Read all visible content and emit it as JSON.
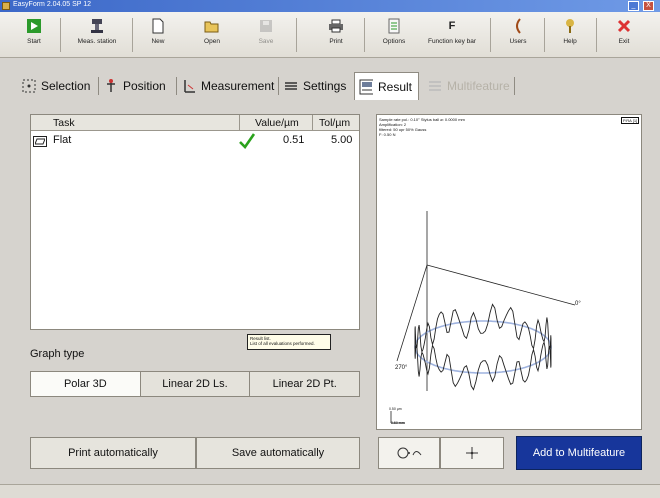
{
  "window": {
    "title": "EasyForm 2.04.05 SP 12",
    "minimize_glyph": "_",
    "close_glyph": "X"
  },
  "toolbar": [
    {
      "id": "start",
      "label": "Start",
      "icon": "play-icon",
      "enabled": true
    },
    {
      "id": "meas-station",
      "label": "Meas. station",
      "icon": "machine-icon",
      "enabled": true
    },
    {
      "id": "new",
      "label": "New",
      "icon": "new-document-icon",
      "enabled": true
    },
    {
      "id": "open",
      "label": "Open",
      "icon": "open-folder-icon",
      "enabled": true
    },
    {
      "id": "save",
      "label": "Save",
      "icon": "save-icon",
      "enabled": false
    },
    {
      "id": "print",
      "label": "Print",
      "icon": "printer-icon",
      "enabled": true
    },
    {
      "id": "options",
      "label": "Options",
      "icon": "options-icon",
      "enabled": true
    },
    {
      "id": "function-key-bar",
      "label": "Function key bar",
      "icon": "function-key-icon",
      "glyph": "F",
      "enabled": true
    },
    {
      "id": "users",
      "label": "Users",
      "icon": "users-icon",
      "enabled": true
    },
    {
      "id": "help",
      "label": "Help",
      "icon": "help-icon",
      "enabled": true
    },
    {
      "id": "exit",
      "label": "Exit",
      "icon": "exit-icon",
      "enabled": true
    }
  ],
  "tabs": [
    {
      "label": "Selection",
      "icon": "selection-icon"
    },
    {
      "label": "Position",
      "icon": "position-icon"
    },
    {
      "label": "Measurement",
      "icon": "measurement-icon"
    },
    {
      "label": "Settings",
      "icon": "settings-icon"
    },
    {
      "label": "Result",
      "icon": "result-icon",
      "active": true
    },
    {
      "label": "Multifeature",
      "icon": "multifeature-icon",
      "enabled": false
    }
  ],
  "task_table": {
    "headers": {
      "task": "Task",
      "value": "Value/µm",
      "tol": "Tol/µm"
    },
    "rows": [
      {
        "task": "Flat",
        "status": "pass",
        "value": "0.51",
        "tol": "5.00"
      }
    ]
  },
  "tooltip": {
    "line1": "Result list.",
    "line2": "List of all evaluations performed."
  },
  "graph_type": {
    "label": "Graph type",
    "options": [
      "Polar 3D",
      "Linear 2D Ls.",
      "Linear 2D Pt."
    ],
    "selected": "Polar 3D"
  },
  "buttons": {
    "print_auto": "Print automatically",
    "save_auto": "Save automatically",
    "add_multifeature": "Add to Multifeature"
  },
  "graph": {
    "info_lines": [
      "Sample rate pol.: 0.10° Stylus ball ø: 0.0000 mm",
      "Amplification: 2",
      "filtered: 50 upr 50% Gauss",
      "F: 0.50 N"
    ],
    "corner_label": "P.RA [1]",
    "axis_0": "0°",
    "axis_270": "270°",
    "scale_z": "0.50 µm",
    "scale_x": "0.50 mm"
  },
  "colors": {
    "accent": "#17369b",
    "pass_check": "#2aa21c",
    "trace": "#222222",
    "reference": "#9fb3df"
  }
}
